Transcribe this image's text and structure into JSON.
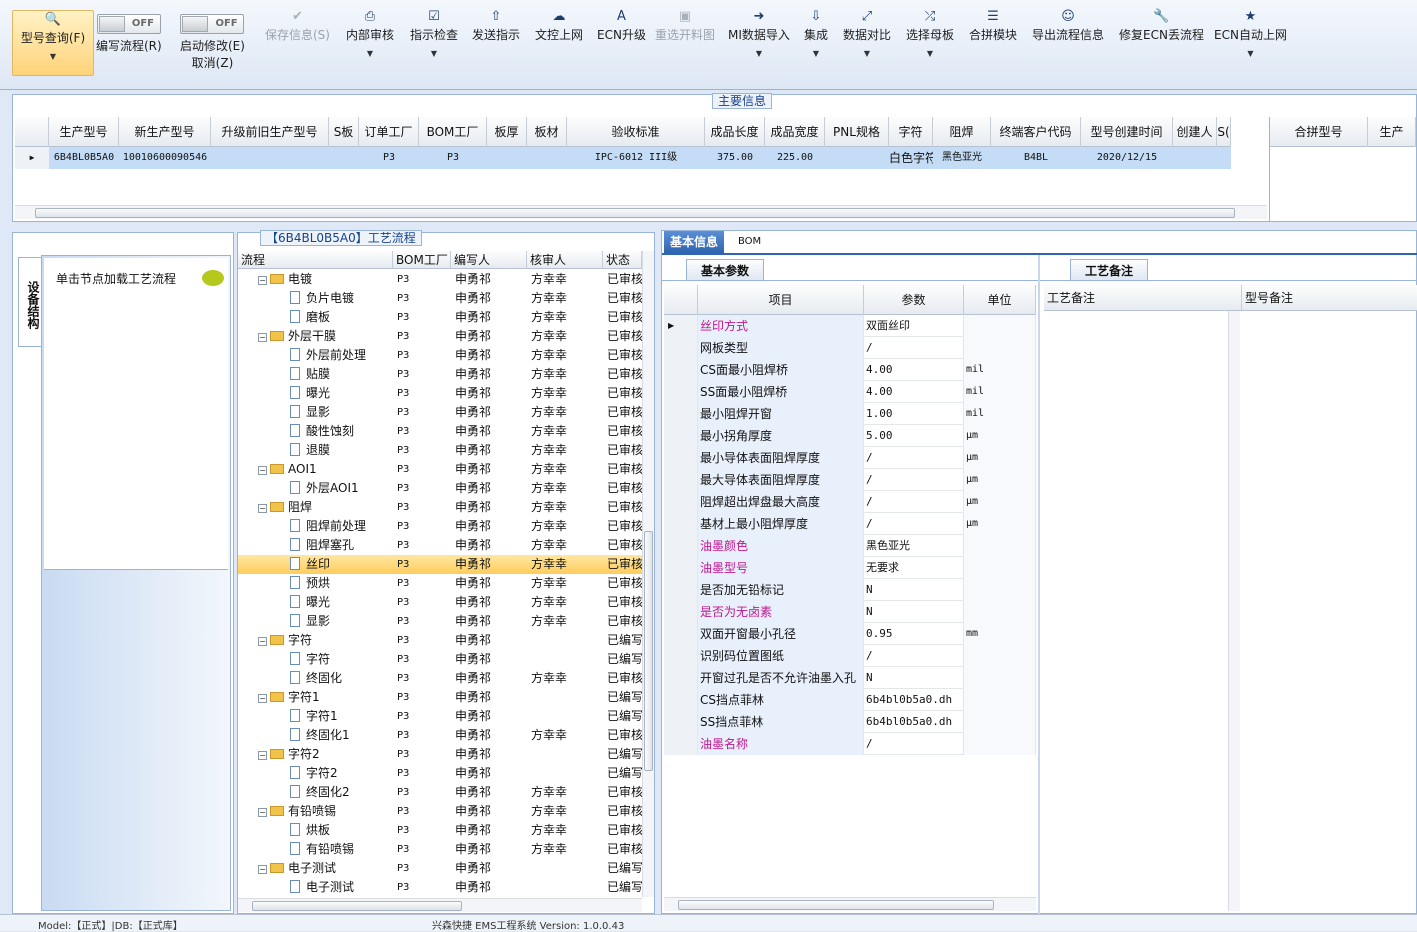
{
  "toolbar": {
    "query": "型号查询(F)",
    "write_flow_state": "OFF",
    "write_flow": "编写流程(R)",
    "start_modify_state": "OFF",
    "start_modify": "启动修改(E)",
    "cancel": "取消(Z)",
    "save": "保存信息(S)",
    "internal_review": "内部审核",
    "instruct_check": "指示检查",
    "send_instruct": "发送指示",
    "doc_upload": "文控上网",
    "ecn_upgrade": "ECN升级",
    "reselect_material": "重选开料图",
    "mi_import": "MI数据导入",
    "integrate": "集成",
    "data_compare": "数据对比",
    "select_mother": "选择母板",
    "combine_module": "合拼模块",
    "export_flow": "导出流程信息",
    "fix_ecn": "修复ECN丢流程",
    "ecn_auto": "ECN自动上网"
  },
  "main_info": {
    "title": "主要信息",
    "columns": [
      "生产型号",
      "新生产型号",
      "升级前旧生产型号",
      "S板",
      "订单工厂",
      "BOM工厂",
      "板厚",
      "板材",
      "验收标准",
      "成品长度",
      "成品宽度",
      "PNL规格",
      "字符",
      "阻焊",
      "终端客户代码",
      "型号创建时间",
      "创建人",
      "S("
    ],
    "row": [
      "6B4BL0B5A0",
      "10010600090546",
      "",
      "",
      "P3",
      "P3",
      "",
      "",
      "IPC-6012 III级",
      "375.00",
      "225.00",
      "",
      "白色字符",
      "黑色亚光",
      "B4BL",
      "2020/12/15",
      "",
      ""
    ],
    "side_columns": [
      "合拼型号",
      "生产"
    ]
  },
  "left": {
    "vtab": "设备结构",
    "hint": "单击节点加载工艺流程"
  },
  "process": {
    "title": "【6B4BL0B5A0】工艺流程",
    "columns": [
      "流程",
      "BOM工厂",
      "编写人",
      "核审人",
      "状态"
    ],
    "rows": [
      {
        "name": "电镀",
        "bom": "P3",
        "writer": "申勇祁",
        "reviewer": "方幸幸",
        "status": "已审核",
        "folder": true
      },
      {
        "name": "负片电镀",
        "bom": "P3",
        "writer": "申勇祁",
        "reviewer": "方幸幸",
        "status": "已审核",
        "folder": false
      },
      {
        "name": "磨板",
        "bom": "P3",
        "writer": "申勇祁",
        "reviewer": "方幸幸",
        "status": "已审核",
        "folder": false
      },
      {
        "name": "外层干膜",
        "bom": "P3",
        "writer": "申勇祁",
        "reviewer": "方幸幸",
        "status": "已审核",
        "folder": true
      },
      {
        "name": "外层前处理",
        "bom": "P3",
        "writer": "申勇祁",
        "reviewer": "方幸幸",
        "status": "已审核",
        "folder": false
      },
      {
        "name": "贴膜",
        "bom": "P3",
        "writer": "申勇祁",
        "reviewer": "方幸幸",
        "status": "已审核",
        "folder": false
      },
      {
        "name": "曝光",
        "bom": "P3",
        "writer": "申勇祁",
        "reviewer": "方幸幸",
        "status": "已审核",
        "folder": false
      },
      {
        "name": "显影",
        "bom": "P3",
        "writer": "申勇祁",
        "reviewer": "方幸幸",
        "status": "已审核",
        "folder": false
      },
      {
        "name": "酸性蚀刻",
        "bom": "P3",
        "writer": "申勇祁",
        "reviewer": "方幸幸",
        "status": "已审核",
        "folder": false
      },
      {
        "name": "退膜",
        "bom": "P3",
        "writer": "申勇祁",
        "reviewer": "方幸幸",
        "status": "已审核",
        "folder": false
      },
      {
        "name": "AOI1",
        "bom": "P3",
        "writer": "申勇祁",
        "reviewer": "方幸幸",
        "status": "已审核",
        "folder": true
      },
      {
        "name": "外层AOI1",
        "bom": "P3",
        "writer": "申勇祁",
        "reviewer": "方幸幸",
        "status": "已审核",
        "folder": false
      },
      {
        "name": "阻焊",
        "bom": "P3",
        "writer": "申勇祁",
        "reviewer": "方幸幸",
        "status": "已审核",
        "folder": true
      },
      {
        "name": "阻焊前处理",
        "bom": "P3",
        "writer": "申勇祁",
        "reviewer": "方幸幸",
        "status": "已审核",
        "folder": false
      },
      {
        "name": "阻焊塞孔",
        "bom": "P3",
        "writer": "申勇祁",
        "reviewer": "方幸幸",
        "status": "已审核",
        "folder": false
      },
      {
        "name": "丝印",
        "bom": "P3",
        "writer": "申勇祁",
        "reviewer": "方幸幸",
        "status": "已审核",
        "folder": false,
        "selected": true
      },
      {
        "name": "预烘",
        "bom": "P3",
        "writer": "申勇祁",
        "reviewer": "方幸幸",
        "status": "已审核",
        "folder": false
      },
      {
        "name": "曝光",
        "bom": "P3",
        "writer": "申勇祁",
        "reviewer": "方幸幸",
        "status": "已审核",
        "folder": false
      },
      {
        "name": "显影",
        "bom": "P3",
        "writer": "申勇祁",
        "reviewer": "方幸幸",
        "status": "已审核",
        "folder": false
      },
      {
        "name": "字符",
        "bom": "P3",
        "writer": "申勇祁",
        "reviewer": "",
        "status": "已编写",
        "folder": true
      },
      {
        "name": "字符",
        "bom": "P3",
        "writer": "申勇祁",
        "reviewer": "",
        "status": "已编写",
        "folder": false
      },
      {
        "name": "终固化",
        "bom": "P3",
        "writer": "申勇祁",
        "reviewer": "方幸幸",
        "status": "已审核",
        "folder": false
      },
      {
        "name": "字符1",
        "bom": "P3",
        "writer": "申勇祁",
        "reviewer": "",
        "status": "已编写",
        "folder": true
      },
      {
        "name": "字符1",
        "bom": "P3",
        "writer": "申勇祁",
        "reviewer": "",
        "status": "已编写",
        "folder": false
      },
      {
        "name": "终固化1",
        "bom": "P3",
        "writer": "申勇祁",
        "reviewer": "方幸幸",
        "status": "已审核",
        "folder": false
      },
      {
        "name": "字符2",
        "bom": "P3",
        "writer": "申勇祁",
        "reviewer": "",
        "status": "已编写",
        "folder": true
      },
      {
        "name": "字符2",
        "bom": "P3",
        "writer": "申勇祁",
        "reviewer": "",
        "status": "已编写",
        "folder": false
      },
      {
        "name": "终固化2",
        "bom": "P3",
        "writer": "申勇祁",
        "reviewer": "方幸幸",
        "status": "已审核",
        "folder": false
      },
      {
        "name": "有铅喷锡",
        "bom": "P3",
        "writer": "申勇祁",
        "reviewer": "方幸幸",
        "status": "已审核",
        "folder": true
      },
      {
        "name": "烘板",
        "bom": "P3",
        "writer": "申勇祁",
        "reviewer": "方幸幸",
        "status": "已审核",
        "folder": false
      },
      {
        "name": "有铅喷锡",
        "bom": "P3",
        "writer": "申勇祁",
        "reviewer": "方幸幸",
        "status": "已审核",
        "folder": false
      },
      {
        "name": "电子测试",
        "bom": "P3",
        "writer": "申勇祁",
        "reviewer": "",
        "status": "已编写",
        "folder": true
      },
      {
        "name": "电子测试",
        "bom": "P3",
        "writer": "申勇祁",
        "reviewer": "",
        "status": "已编写",
        "folder": false
      }
    ]
  },
  "right": {
    "tab_basic": "基本信息",
    "tab_bom": "BOM",
    "sub_basic": "基本参数",
    "sub_craft": "工艺备注",
    "col_item": "项目",
    "col_param": "参数",
    "col_unit": "单位",
    "craft_note": "工艺备注",
    "model_note": "型号备注",
    "params": [
      {
        "name": "丝印方式",
        "value": "双面丝印",
        "unit": "",
        "mag": true,
        "sel": true
      },
      {
        "name": "网板类型",
        "value": "/",
        "unit": "",
        "mag": false
      },
      {
        "name": "CS面最小阻焊桥",
        "value": "4.00",
        "unit": "mil",
        "mag": false
      },
      {
        "name": "SS面最小阻焊桥",
        "value": "4.00",
        "unit": "mil",
        "mag": false
      },
      {
        "name": "最小阻焊开窗",
        "value": "1.00",
        "unit": "mil",
        "mag": false
      },
      {
        "name": "最小拐角厚度",
        "value": "5.00",
        "unit": "μm",
        "mag": false
      },
      {
        "name": "最小导体表面阻焊厚度",
        "value": "/",
        "unit": "μm",
        "mag": false
      },
      {
        "name": "最大导体表面阻焊厚度",
        "value": "/",
        "unit": "μm",
        "mag": false
      },
      {
        "name": "阻焊超出焊盘最大高度",
        "value": "/",
        "unit": "μm",
        "mag": false
      },
      {
        "name": "基材上最小阻焊厚度",
        "value": "/",
        "unit": "μm",
        "mag": false
      },
      {
        "name": "油墨颜色",
        "value": "黑色亚光",
        "unit": "",
        "mag": true
      },
      {
        "name": "油墨型号",
        "value": "无要求",
        "unit": "",
        "mag": true
      },
      {
        "name": "是否加无铅标记",
        "value": "N",
        "unit": "",
        "mag": false
      },
      {
        "name": "是否为无卤素",
        "value": "N",
        "unit": "",
        "mag": true
      },
      {
        "name": "双面开窗最小孔径",
        "value": "0.95",
        "unit": "mm",
        "mag": false
      },
      {
        "name": "识别码位置图纸",
        "value": "/",
        "unit": "",
        "mag": false
      },
      {
        "name": "开窗过孔是否不允许油墨入孔",
        "value": "N",
        "unit": "",
        "mag": false
      },
      {
        "name": "CS挡点菲林",
        "value": "6b4bl0b5a0.dh",
        "unit": "",
        "mag": false
      },
      {
        "name": "SS挡点菲林",
        "value": "6b4bl0b5a0.dh",
        "unit": "",
        "mag": false
      },
      {
        "name": "油墨名称",
        "value": "/",
        "unit": "",
        "mag": true
      }
    ]
  },
  "status": {
    "left": "Model:【正式】|DB:【正式库】",
    "center": "兴森快捷 EMS工程系统 Version: 1.0.0.43"
  },
  "colors": {
    "accent": "#2e64b0",
    "selection": "#ffcd5c",
    "row_highlight": "#c4dcf5",
    "magenta": "#c0178f"
  }
}
